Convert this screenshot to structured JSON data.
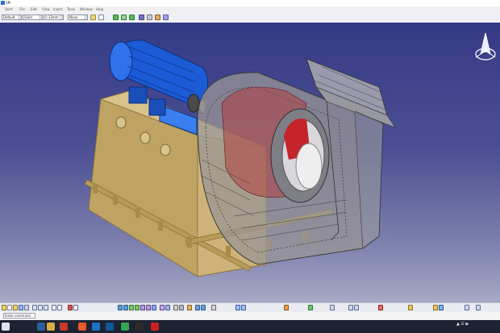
{
  "window": {
    "title": "IA"
  },
  "menu": {
    "items": [
      "Start",
      "File",
      "Edit",
      "View",
      "Insert",
      "Tools",
      "Window",
      "Help"
    ]
  },
  "toolbar": {
    "combos": [
      {
        "value": "Default",
        "name": "color"
      },
      {
        "value": "Solid",
        "name": "linetype"
      },
      {
        "value": "0.13mm",
        "name": "thickness"
      },
      {
        "value": "None",
        "name": "layer"
      }
    ]
  },
  "statusbar": {
    "command_placeholder": "Enter command"
  },
  "icons": {
    "compass": "compass-icon",
    "app": "catia-app-icon"
  },
  "colors": {
    "viewport_top": "#353a86",
    "viewport_bottom": "#a7a9c6",
    "motor": "#1c5bd6",
    "frame": "#cdb37a",
    "housing": "#8d8a8a",
    "impeller": "#c42a2a"
  }
}
